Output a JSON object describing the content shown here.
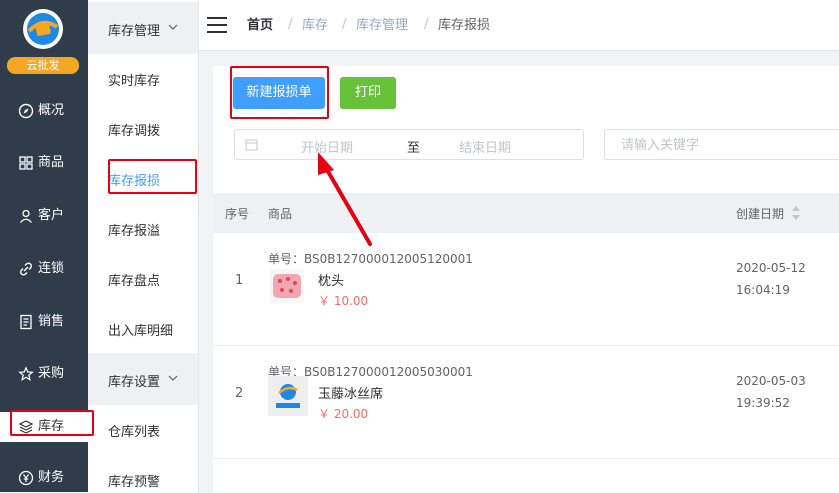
{
  "brand": {
    "name": "云批发"
  },
  "rail": {
    "items": [
      {
        "label": "概况",
        "icon": "compass-icon"
      },
      {
        "label": "商品",
        "icon": "grid-icon"
      },
      {
        "label": "客户",
        "icon": "user-icon"
      },
      {
        "label": "连锁",
        "icon": "link-icon"
      },
      {
        "label": "销售",
        "icon": "document-icon"
      },
      {
        "label": "采购",
        "icon": "star-icon"
      },
      {
        "label": "库存",
        "icon": "layers-icon",
        "active": true
      },
      {
        "label": "财务",
        "icon": "yen-icon"
      }
    ]
  },
  "submenu": {
    "group1": "库存管理",
    "items1": [
      "实时库存",
      "库存调拨",
      "库存报损",
      "库存报溢",
      "库存盘点",
      "出入库明细"
    ],
    "active": "库存报损",
    "group2": "库存设置",
    "items2": [
      "仓库列表",
      "库存预警"
    ]
  },
  "breadcrumb": {
    "home": "首页",
    "c1": "库存",
    "c2": "库存管理",
    "c3": "库存报损"
  },
  "toolbar": {
    "new_label": "新建报损单",
    "print_label": "打印"
  },
  "filters": {
    "start_placeholder": "开始日期",
    "to": "至",
    "end_placeholder": "结束日期",
    "keyword_placeholder": "请输入关键字"
  },
  "table": {
    "headers": {
      "idx": "序号",
      "product": "商品",
      "created": "创建日期"
    },
    "rows": [
      {
        "idx": "1",
        "no": "单号：BS0B127000012005120001",
        "name": "枕头",
        "price": "￥ 10.00",
        "date": "2020-05-12",
        "time": "16:04:19",
        "thumb": "pillow"
      },
      {
        "idx": "2",
        "no": "单号：BS0B127000012005030001",
        "name": "玉藤冰丝席",
        "price": "￥ 20.00",
        "date": "2020-05-03",
        "time": "19:39:52",
        "thumb": "logo"
      }
    ]
  },
  "colors": {
    "primary": "#409eff",
    "success": "#67c23a",
    "rail_bg": "#2f3d4b",
    "price": "#f56c6c",
    "highlight": "#e60012"
  }
}
